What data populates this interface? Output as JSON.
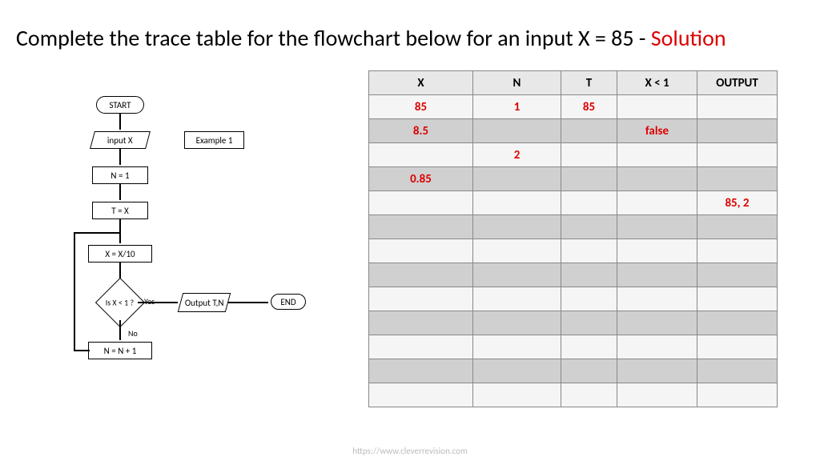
{
  "title_main": "Complete the trace table for the flowchart below for an input X = 85 - ",
  "title_sol": "Solution",
  "flowchart": {
    "start": "START",
    "inputx": "input X",
    "ex1": "Example 1",
    "n1": "N = 1",
    "tx": "T = X",
    "x10": "X = X/10",
    "dec": "Is X < 1 ?",
    "yes": "Yes",
    "no": "No",
    "out": "Output T,N",
    "end": "END",
    "nplus": "N = N + 1"
  },
  "headers": [
    "X",
    "N",
    "T",
    "X < 1",
    "OUTPUT"
  ],
  "rows": [
    [
      {
        "v": "85",
        "r": true
      },
      {
        "v": "1",
        "r": true
      },
      {
        "v": "85",
        "r": true
      },
      {
        "v": ""
      },
      {
        "v": ""
      }
    ],
    [
      {
        "v": "8.5",
        "r": true
      },
      {
        "v": ""
      },
      {
        "v": ""
      },
      {
        "v": "false",
        "r": true
      },
      {
        "v": ""
      }
    ],
    [
      {
        "v": ""
      },
      {
        "v": "2",
        "r": true
      },
      {
        "v": ""
      },
      {
        "v": ""
      },
      {
        "v": ""
      }
    ],
    [
      {
        "v": "0.85",
        "r": true
      },
      {
        "v": ""
      },
      {
        "v": ""
      },
      {
        "v": ""
      },
      {
        "v": ""
      }
    ],
    [
      {
        "v": ""
      },
      {
        "v": ""
      },
      {
        "v": ""
      },
      {
        "v": ""
      },
      {
        "v": "85, 2",
        "r": true
      }
    ],
    [
      {
        "v": ""
      },
      {
        "v": ""
      },
      {
        "v": ""
      },
      {
        "v": ""
      },
      {
        "v": ""
      }
    ],
    [
      {
        "v": ""
      },
      {
        "v": ""
      },
      {
        "v": ""
      },
      {
        "v": ""
      },
      {
        "v": ""
      }
    ],
    [
      {
        "v": ""
      },
      {
        "v": ""
      },
      {
        "v": ""
      },
      {
        "v": ""
      },
      {
        "v": ""
      }
    ],
    [
      {
        "v": ""
      },
      {
        "v": ""
      },
      {
        "v": ""
      },
      {
        "v": ""
      },
      {
        "v": ""
      }
    ],
    [
      {
        "v": ""
      },
      {
        "v": ""
      },
      {
        "v": ""
      },
      {
        "v": ""
      },
      {
        "v": ""
      }
    ],
    [
      {
        "v": ""
      },
      {
        "v": ""
      },
      {
        "v": ""
      },
      {
        "v": ""
      },
      {
        "v": ""
      }
    ],
    [
      {
        "v": ""
      },
      {
        "v": ""
      },
      {
        "v": ""
      },
      {
        "v": ""
      },
      {
        "v": ""
      }
    ],
    [
      {
        "v": ""
      },
      {
        "v": ""
      },
      {
        "v": ""
      },
      {
        "v": ""
      },
      {
        "v": ""
      }
    ]
  ],
  "footer": "https://www.cleverrevision.com"
}
